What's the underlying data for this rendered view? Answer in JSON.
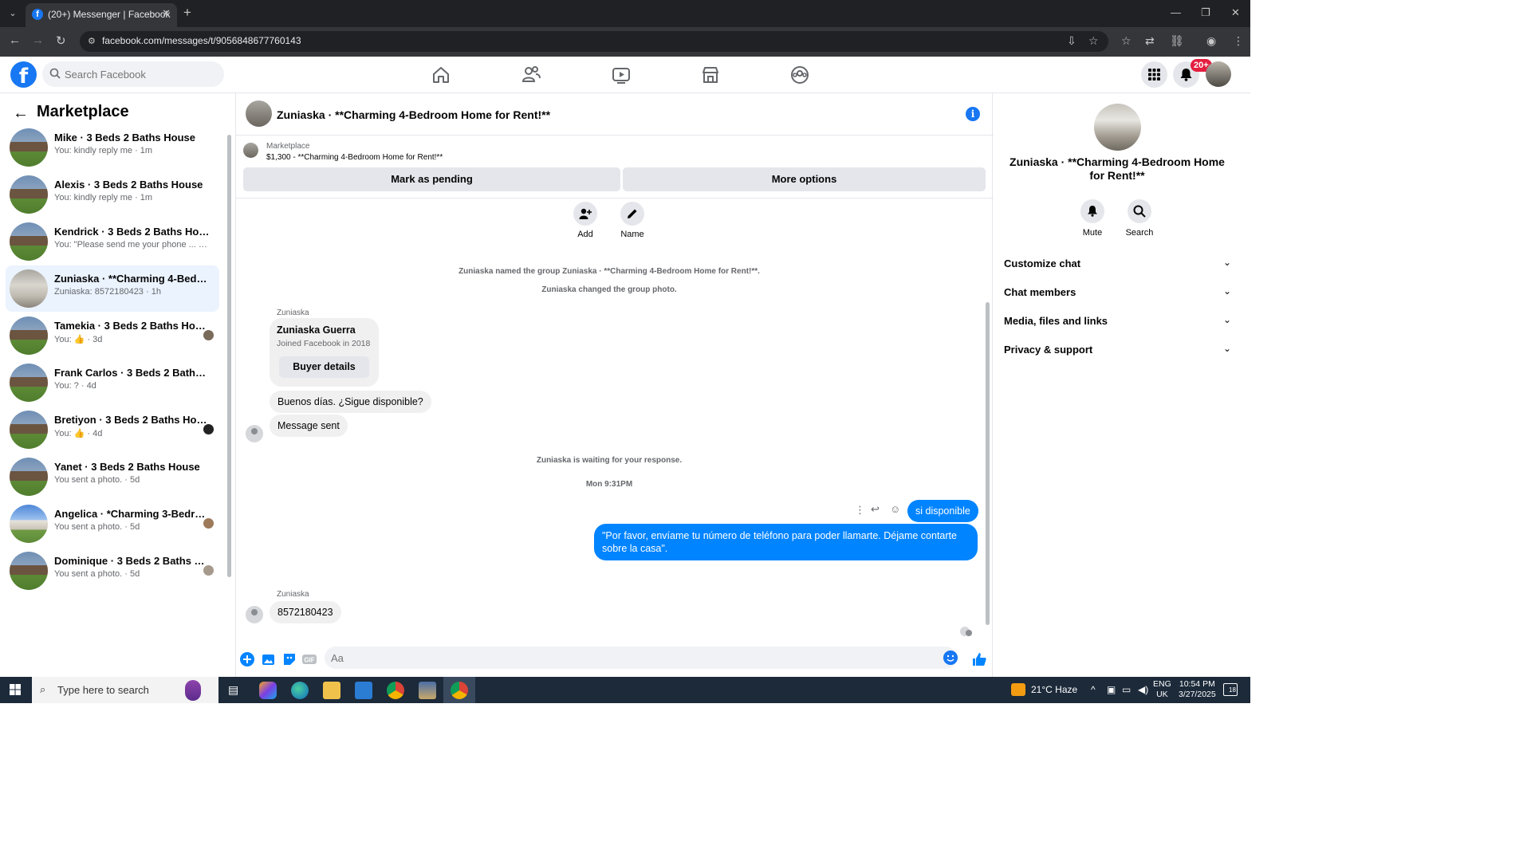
{
  "browser": {
    "tab_title": "(20+) Messenger | Facebook",
    "url": "facebook.com/messages/t/9056848677760143"
  },
  "fb": {
    "search_placeholder": "Search Facebook",
    "notif_badge": "20+",
    "brand_color": "#1877f2"
  },
  "left": {
    "title": "Marketplace",
    "conversations": [
      {
        "name": "Mike · 3 Beds 2 Baths House",
        "sub": "You: kindly reply me · 1m"
      },
      {
        "name": "Alexis · 3 Beds 2 Baths House",
        "sub": "You: kindly reply me · 1m"
      },
      {
        "name": "Kendrick · 3 Beds 2 Baths House",
        "sub": "You: \"Please send me your phone ... · 1m"
      },
      {
        "name": "Zuniaska · **Charming 4-Bedroo...",
        "sub": "Zuniaska: 8572180423 · 1h"
      },
      {
        "name": "Tamekia · 3 Beds 2 Baths House",
        "sub": "You: 👍 · 3d"
      },
      {
        "name": "Frank Carlos · 3 Beds 2 Baths Ho...",
        "sub": "You: ? · 4d"
      },
      {
        "name": "Bretiyon · 3 Beds 2 Baths House",
        "sub": "You: 👍 · 4d"
      },
      {
        "name": "Yanet · 3 Beds 2 Baths House",
        "sub": "You sent a photo. · 5d"
      },
      {
        "name": "Angelica · *Charming 3-Bedro...",
        "sub": "You sent a photo. · 5d"
      },
      {
        "name": "Dominique · 3 Beds 2 Baths H...",
        "sub": "You sent a photo. · 5d"
      }
    ]
  },
  "chat": {
    "title": "Zuniaska · **Charming 4-Bedroom Home for Rent!**",
    "marketplace_label": "Marketplace",
    "listing": "$1,300 - **Charming 4-Bedroom Home for Rent!**",
    "mark_pending": "Mark as pending",
    "more_options": "More options",
    "add_label": "Add",
    "name_label": "Name",
    "sys_named": "Zuniaska named the group Zuniaska · **Charming 4-Bedroom Home for Rent!**.",
    "sys_photo": "Zuniaska changed the group photo.",
    "sender": "Zuniaska",
    "card_name": "Zuniaska Guerra",
    "card_sub": "Joined Facebook in 2018",
    "buyer_details": "Buyer details",
    "msg_in_1": "Buenos días. ¿Sigue disponible?",
    "msg_in_2": "Message sent",
    "sys_waiting": "Zuniaska is waiting for your response.",
    "timestamp": "Mon 9:31PM",
    "msg_out_1": "si disponible",
    "msg_out_2": "\"Por favor, envíame tu número de teléfono para poder llamarte. Déjame contarte sobre la casa\".",
    "msg_in_3": "8572180423",
    "composer_placeholder": "Aa"
  },
  "right": {
    "title": "Zuniaska · **Charming 4-Bedroom Home for Rent!**",
    "mute": "Mute",
    "search": "Search",
    "sections": [
      "Customize chat",
      "Chat members",
      "Media, files and links",
      "Privacy & support"
    ]
  },
  "taskbar": {
    "search_placeholder": "Type here to search",
    "weather": "21°C  Haze",
    "lang_1": "ENG",
    "lang_2": "UK",
    "time": "10:54 PM",
    "date": "3/27/2025",
    "notif_count": "18"
  }
}
